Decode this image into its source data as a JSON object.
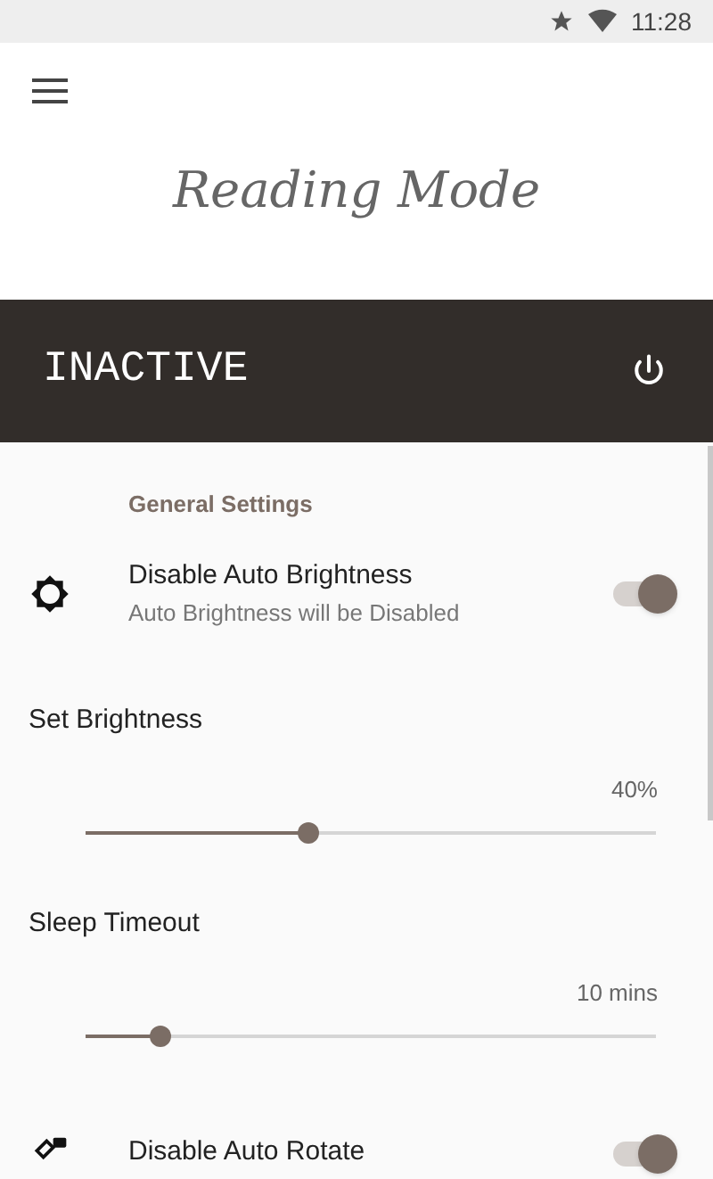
{
  "status_bar": {
    "time": "11:28"
  },
  "app_title": "Reading Mode",
  "status_banner": {
    "label": "INACTIVE"
  },
  "section_title": "General Settings",
  "settings": [
    {
      "kind": "toggle",
      "title": "Disable Auto Brightness",
      "subtitle": "Auto Brightness will be Disabled",
      "on": true
    },
    {
      "kind": "slider",
      "title": "Set Brightness",
      "reading": "40%",
      "level": 0.39
    },
    {
      "kind": "slider",
      "title": "Sleep Timeout",
      "reading": "10 mins",
      "level": 0.13
    },
    {
      "kind": "toggle",
      "title": "Disable Auto Rotate",
      "on": true
    }
  ]
}
